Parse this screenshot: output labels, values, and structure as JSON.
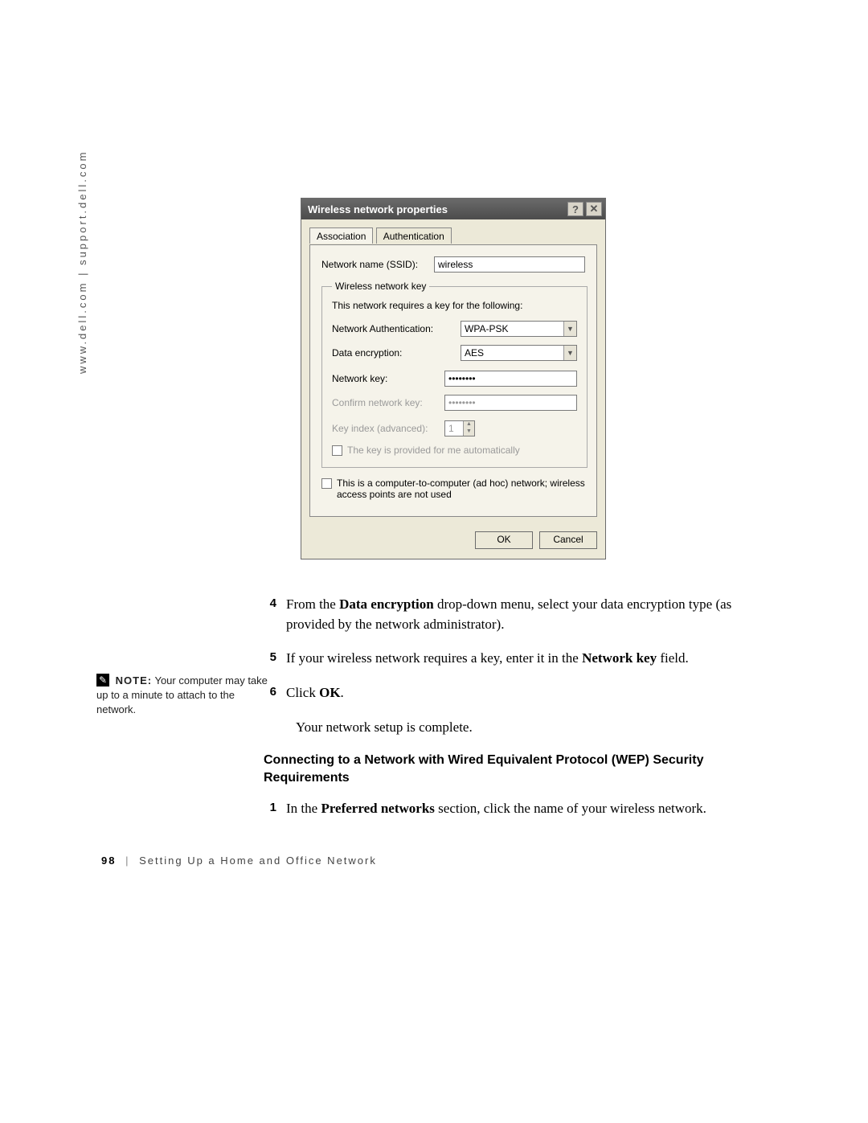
{
  "side_text": "www.dell.com | support.dell.com",
  "footer": {
    "page_number": "98",
    "separator": "|",
    "chapter": "Setting Up a Home and Office Network"
  },
  "note": {
    "icon_glyph": "✎",
    "label": "NOTE:",
    "text": "Your computer may take up to a minute to attach to the network."
  },
  "steps": {
    "s4": {
      "num": "4",
      "pre": "From the ",
      "bold": "Data encryption",
      "post": " drop-down menu, select your data encryption type (as provided by the network administrator)."
    },
    "s5": {
      "num": "5",
      "pre": "If your wireless network requires a key, enter it in the ",
      "bold": "Network key",
      "post": " field."
    },
    "s6": {
      "num": "6",
      "pre": "Click ",
      "bold": "OK",
      "post": ".",
      "sub": "Your network setup is complete."
    }
  },
  "subhead": "Connecting to a Network with Wired Equivalent Protocol (WEP) Security Requirements",
  "step_wep1": {
    "num": "1",
    "pre": "In the ",
    "bold": "Preferred networks",
    "post": " section, click the name of your wireless network."
  },
  "dialog": {
    "title": "Wireless network properties",
    "help_glyph": "?",
    "close_glyph": "✕",
    "tabs": {
      "association": "Association",
      "authentication": "Authentication"
    },
    "ssid": {
      "label": "Network name (SSID):",
      "value": "wireless"
    },
    "group_legend": "Wireless network key",
    "group_intro": "This network requires a key for the following:",
    "net_auth": {
      "label": "Network Authentication:",
      "value": "WPA-PSK"
    },
    "data_enc": {
      "label": "Data encryption:",
      "value": "AES"
    },
    "net_key": {
      "label": "Network key:",
      "value": "••••••••"
    },
    "confirm_key": {
      "label": "Confirm network key:",
      "value": "••••••••"
    },
    "key_index": {
      "label": "Key index (advanced):",
      "value": "1"
    },
    "auto_key": "The key is provided for me automatically",
    "adhoc": "This is a computer-to-computer (ad hoc) network; wireless access points are not used",
    "ok": "OK",
    "cancel": "Cancel"
  }
}
